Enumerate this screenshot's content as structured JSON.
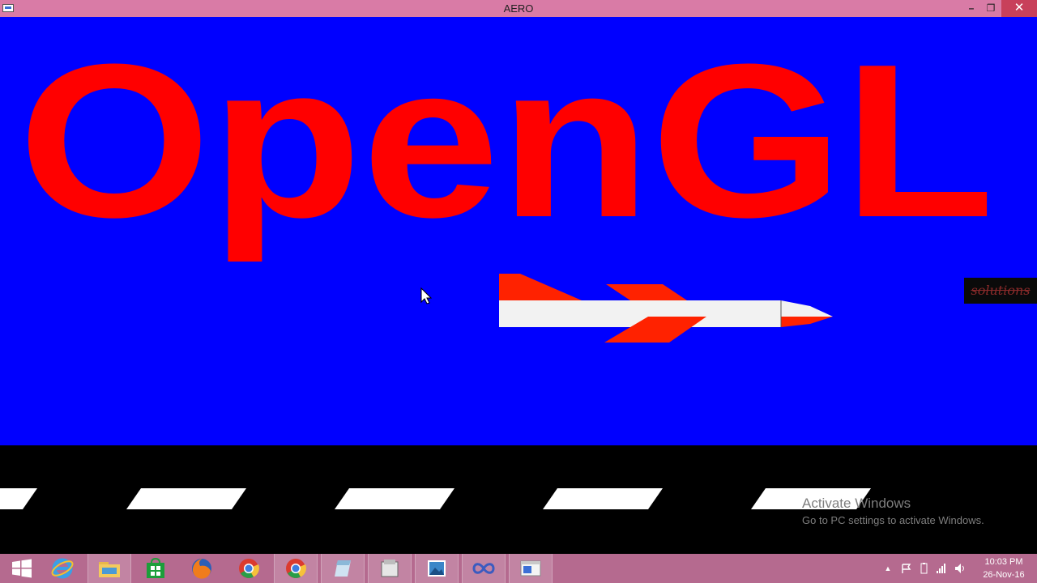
{
  "window": {
    "title": "AERO",
    "minimize": "–",
    "maximize": "❐",
    "close": "✕"
  },
  "scene": {
    "heading": "OpenGL",
    "watermark_badge": "solutions"
  },
  "activation": {
    "line1": "Activate Windows",
    "line2": "Go to PC settings to activate Windows."
  },
  "taskbar": {
    "apps": [
      "start-button",
      "internet-explorer",
      "file-explorer",
      "store",
      "firefox",
      "chrome",
      "chrome",
      "app",
      "file-manager",
      "photos",
      "app",
      "opengl-window"
    ],
    "tray_arrow": "▲",
    "time": "10:03 PM",
    "date": "26-Nov-16"
  },
  "colors": {
    "sky": "#0000ff",
    "heading": "#ff0000",
    "plane_body": "#f2f2f2",
    "plane_accent": "#ff2200",
    "road": "#000000",
    "stripe": "#ffffff",
    "taskbar": "#b56a8f"
  }
}
